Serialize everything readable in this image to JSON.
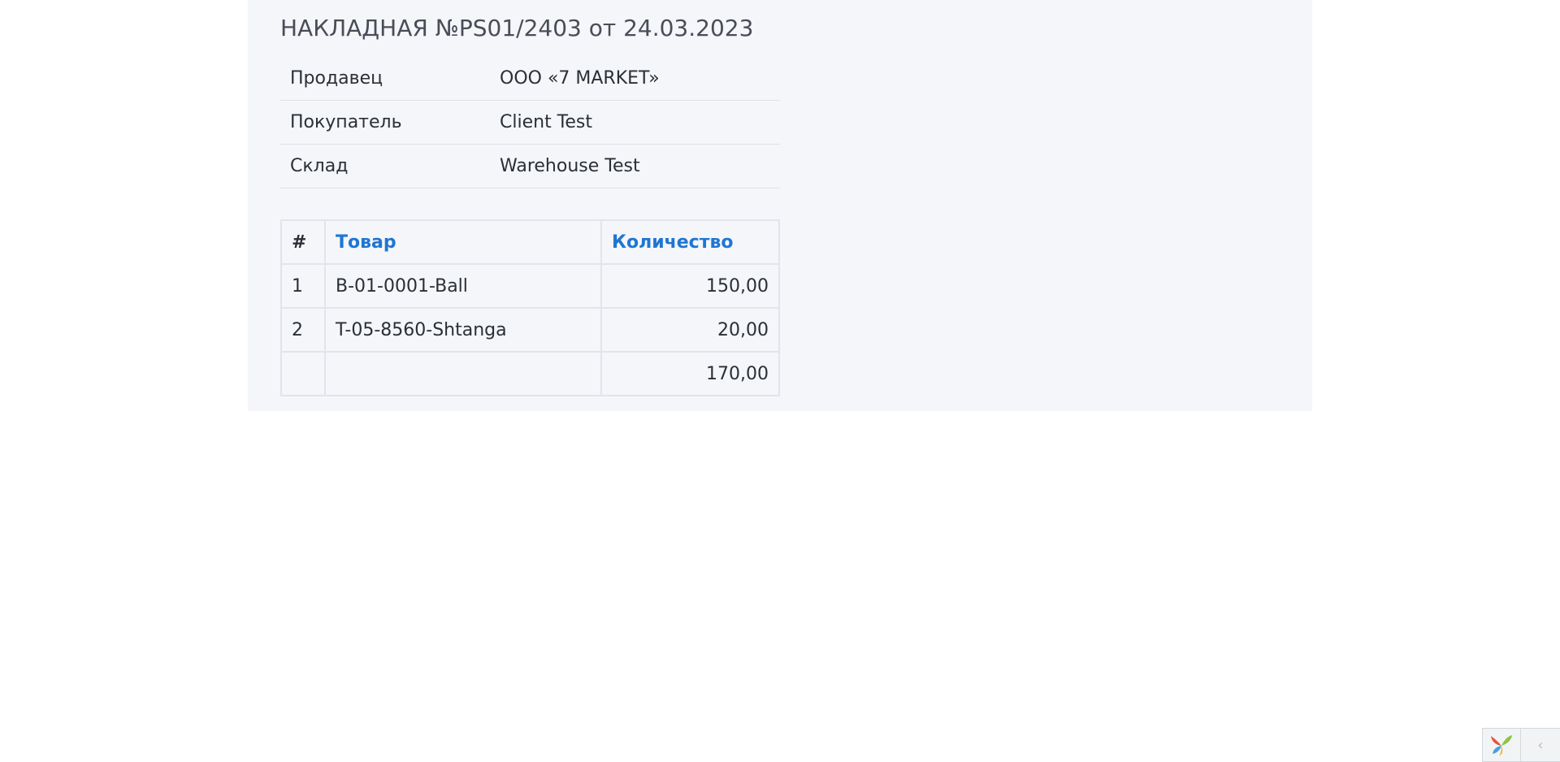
{
  "document": {
    "title": "НАКЛАДНАЯ №PS01/2403 от 24.03.2023",
    "info": [
      {
        "label": "Продавец",
        "value": "ООО «7 MARKET»"
      },
      {
        "label": "Покупатель",
        "value": "Client Test"
      },
      {
        "label": "Склад",
        "value": "Warehouse Test"
      }
    ]
  },
  "items_table": {
    "headers": {
      "num": "#",
      "product": "Товар",
      "quantity": "Количество"
    },
    "rows": [
      {
        "num": "1",
        "product": "B-01-0001-Ball",
        "quantity": "150,00"
      },
      {
        "num": "2",
        "product": "T-05-8560-Shtanga",
        "quantity": "20,00"
      }
    ],
    "total": {
      "num": "",
      "product": "",
      "quantity": "170,00"
    }
  },
  "debug_toolbar": {
    "logo_icon": "yii-logo-icon",
    "toggle_icon": "chevron-left-icon",
    "toggle_glyph": "‹"
  },
  "colors": {
    "page_bg": "#f4f6fa",
    "link": "#1f76d2",
    "text": "#2b2f36"
  }
}
